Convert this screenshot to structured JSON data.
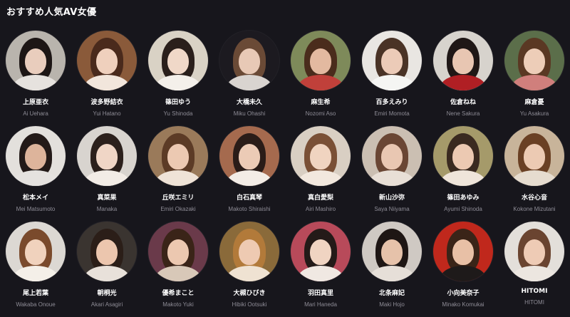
{
  "section": {
    "title": "おすすめ人気AV女優"
  },
  "actresses": [
    {
      "jp": "上原亜衣",
      "en": "Ai Uehara",
      "bg": "#b9b4ad",
      "hair": "#1d1615",
      "skin": "#e9cdbd",
      "top": "#e6e2de"
    },
    {
      "jp": "波多野結衣",
      "en": "Yui Hatano",
      "bg": "#8a5a3a",
      "hair": "#4a2a1c",
      "skin": "#efd0bd",
      "top": "#f2e6dc"
    },
    {
      "jp": "篠田ゆう",
      "en": "Yu Shinoda",
      "bg": "#d9d2c5",
      "hair": "#2a1f1b",
      "skin": "#f0d8c8",
      "top": "#f4f0ea"
    },
    {
      "jp": "大橋未久",
      "en": "Miku Ohashi",
      "bg": "#1c1a20",
      "hair": "#6a4a36",
      "skin": "#e8c9b6",
      "top": "#d9d4d0"
    },
    {
      "jp": "麻生希",
      "en": "Nozomi Aso",
      "bg": "#7e8a5a",
      "hair": "#4a2c1c",
      "skin": "#e3b9a0",
      "top": "#c0403a"
    },
    {
      "jp": "百多えみり",
      "en": "Emiri Momota",
      "bg": "#e9e6e2",
      "hair": "#4a3326",
      "skin": "#eccbb8",
      "top": "#f5f5f3"
    },
    {
      "jp": "佐倉ねね",
      "en": "Nene Sakura",
      "bg": "#d7d3cd",
      "hair": "#1f1716",
      "skin": "#e8c6b2",
      "top": "#b01f24"
    },
    {
      "jp": "麻倉憂",
      "en": "Yu Asakura",
      "bg": "#5b6e4a",
      "hair": "#5a3823",
      "skin": "#edcdb8",
      "top": "#d07f7c"
    },
    {
      "jp": "松本メイ",
      "en": "Mei Matsumoto",
      "bg": "#e3e0dc",
      "hair": "#231a18",
      "skin": "#ddb49b",
      "top": "#e5e2df"
    },
    {
      "jp": "真菜果",
      "en": "Manaka",
      "bg": "#d8d4cf",
      "hair": "#2b201c",
      "skin": "#f0d6c6",
      "top": "#f2ece6"
    },
    {
      "jp": "丘咲エミリ",
      "en": "Emiri Okazaki",
      "bg": "#9a7a5a",
      "hair": "#5c3b26",
      "skin": "#ecc9b2",
      "top": "#efe3d7"
    },
    {
      "jp": "白石真琴",
      "en": "Makoto Shiraishi",
      "bg": "#a56a4e",
      "hair": "#2a1c18",
      "skin": "#eccbb6",
      "top": "#f3ece6"
    },
    {
      "jp": "真白愛梨",
      "en": "Airi Mashiro",
      "bg": "#d9cfc3",
      "hair": "#7a5036",
      "skin": "#f0d4c0",
      "top": "#f2e8de"
    },
    {
      "jp": "新山沙弥",
      "en": "Saya Niiyama",
      "bg": "#cbbfb2",
      "hair": "#6a4634",
      "skin": "#e9c7b2",
      "top": "#e8dfd6"
    },
    {
      "jp": "篠田あゆみ",
      "en": "Ayumi Shinoda",
      "bg": "#a59a6a",
      "hair": "#3a2a20",
      "skin": "#ecc9b2",
      "top": "#efe5da"
    },
    {
      "jp": "水谷心音",
      "en": "Kokone Mizutani",
      "bg": "#c8b49a",
      "hair": "#6a4024",
      "skin": "#eccab3",
      "top": "#e6dccf"
    },
    {
      "jp": "尾上若葉",
      "en": "Wakaba Onoue",
      "bg": "#dcd8d3",
      "hair": "#7a4a2c",
      "skin": "#f0d2bd",
      "top": "#f4efe8"
    },
    {
      "jp": "朝桐光",
      "en": "Akari Asagiri",
      "bg": "#3a3430",
      "hair": "#2b1e18",
      "skin": "#ecc6ae",
      "top": "#e8e1da"
    },
    {
      "jp": "優希まこと",
      "en": "Makoto Yuki",
      "bg": "#6a3a4a",
      "hair": "#3a2418",
      "skin": "#ecc8b0",
      "top": "#d8c8b8"
    },
    {
      "jp": "大槻ひびき",
      "en": "Hibiki Ootsuki",
      "bg": "#8a6a3a",
      "hair": "#b27a3a",
      "skin": "#eecab2",
      "top": "#efe2d2"
    },
    {
      "jp": "羽田真里",
      "en": "Mari Haneda",
      "bg": "#b84a5a",
      "hair": "#241a18",
      "skin": "#f0d4c2",
      "top": "#f0e8e2"
    },
    {
      "jp": "北条麻妃",
      "en": "Maki Hojo",
      "bg": "#cfc9c3",
      "hair": "#1e1614",
      "skin": "#e6c2aa",
      "top": "#e6dfd8"
    },
    {
      "jp": "小向美奈子",
      "en": "Minako Komukai",
      "bg": "#c0281c",
      "hair": "#3a2418",
      "skin": "#e8c0a6",
      "top": "#1e1a1a"
    },
    {
      "jp": "HITOMI",
      "en": "HITOMI",
      "bg": "#e3dfda",
      "hair": "#6a4430",
      "skin": "#eecbb5",
      "top": "#ece6e0"
    }
  ]
}
